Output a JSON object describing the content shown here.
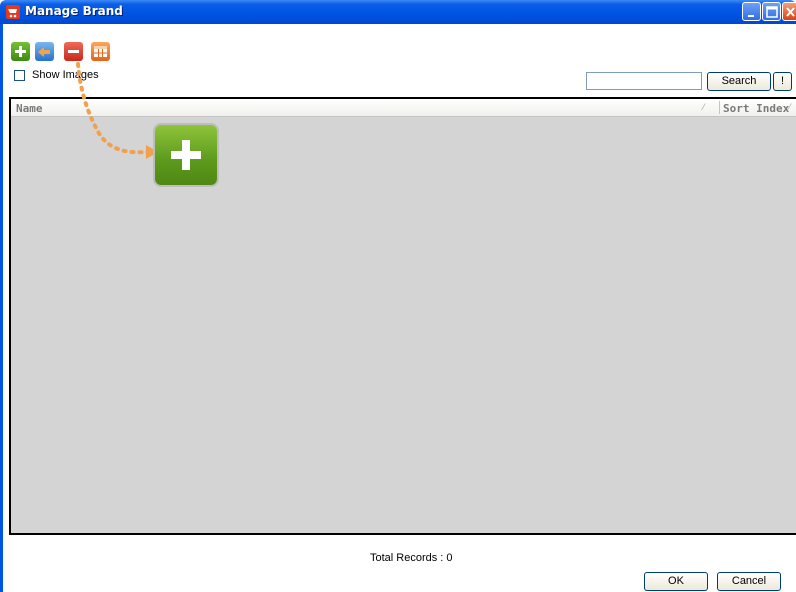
{
  "window": {
    "title": "Manage Brand",
    "title_bar_color": "#0054e3"
  },
  "toolbar": {
    "buttons": [
      {
        "name": "add",
        "icon": "plus-icon",
        "color": "#4a9a18"
      },
      {
        "name": "edit",
        "icon": "edit-arrow-icon",
        "color": "#2f7cd0"
      },
      {
        "name": "delete",
        "icon": "minus-icon",
        "color": "#d8301f"
      },
      {
        "name": "grid",
        "icon": "table-icon",
        "color": "#f07a22"
      }
    ]
  },
  "options": {
    "show_images_label": "Show Images",
    "show_images_checked": false
  },
  "search": {
    "value": "",
    "placeholder": "",
    "button_label": "Search",
    "extra_button_label": "!"
  },
  "grid": {
    "columns": [
      {
        "label": "Name",
        "sort_icon": "sort-icon"
      },
      {
        "label": "Sort Index",
        "sort_icon": "sort-icon"
      }
    ],
    "rows": []
  },
  "overlay": {
    "highlight_icon": "plus-icon",
    "arrow": "dotted-orange-arrow",
    "color": "#f0a050"
  },
  "footer": {
    "total_records": "Total Records : 0",
    "ok_label": "OK",
    "cancel_label": "Cancel"
  }
}
